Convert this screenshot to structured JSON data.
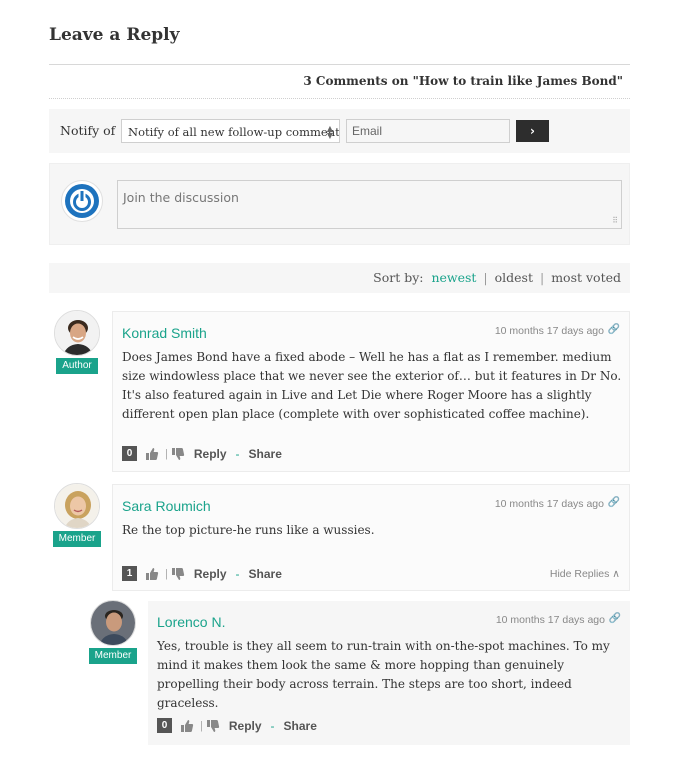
{
  "page": {
    "title": "Leave a Reply"
  },
  "comments_header": "3 Comments on \"How to train like James Bond\"",
  "notify": {
    "label": "Notify of",
    "select_value": "Notify of all new follow-up comments",
    "email_placeholder": "Email",
    "submit_glyph": "›"
  },
  "join": {
    "placeholder": "Join the discussion",
    "resize_glyph": "⠿"
  },
  "sort": {
    "label": "Sort by:",
    "options": [
      "newest",
      "oldest",
      "most voted"
    ],
    "active": "newest",
    "separator": "|"
  },
  "colors": {
    "accent": "#1aa38b",
    "brand_blue": "#1e73be",
    "dark_button": "#2d2d2d"
  },
  "comments": [
    {
      "author": "Konrad Smith",
      "role": "Author",
      "date": "10 months 17 days ago",
      "text": "Does James Bond have a fixed abode – Well he has a flat as I remember. medium size windowless place that we never see the exterior of… but it features in Dr No. It's also featured again in Live and Let Die where Roger Moore has a slightly different open plan place (complete with over sophisticated coffee machine).",
      "votes": "0",
      "reply_label": "Reply",
      "share_label": "Share"
    },
    {
      "author": "Sara Roumich",
      "role": "Member",
      "date": "10 months 17 days ago",
      "text": "Re the top picture-he runs like a wussies.",
      "votes": "1",
      "reply_label": "Reply",
      "share_label": "Share",
      "hide_replies": "Hide Replies ∧"
    },
    {
      "author": "Lorenco N.",
      "role": "Member",
      "date": "10 months 17 days ago",
      "text": "Yes, trouble is they all seem to run-train with on-the-spot machines. To my mind it makes them look the same & more hopping than genuinely propelling their body across terrain. The steps are too short, indeed graceless.",
      "votes": "0",
      "reply_label": "Reply",
      "share_label": "Share"
    }
  ],
  "footer_glyphs": {
    "sep": "|",
    "dash": "-",
    "permalink": "🔗"
  }
}
